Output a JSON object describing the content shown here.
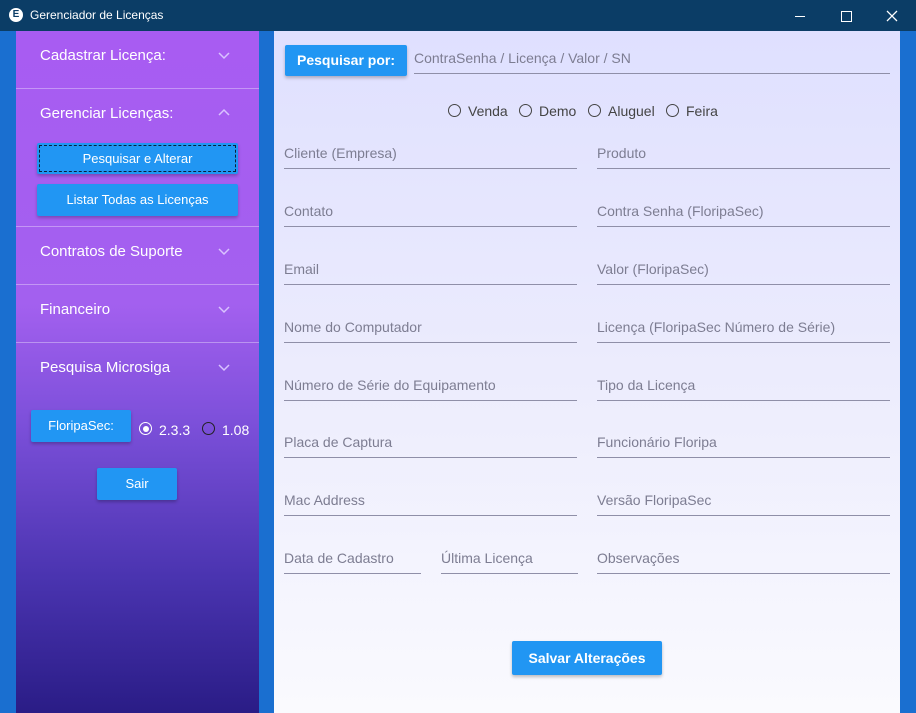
{
  "window": {
    "title": "Gerenciador de Licenças",
    "icon_letter": "E",
    "controls": [
      "minimize-icon",
      "maximize-icon",
      "close-icon"
    ]
  },
  "sidebar": {
    "sections": [
      {
        "label": "Cadastrar Licença:",
        "expanded": false
      },
      {
        "label": "Gerenciar Licenças:",
        "expanded": true
      },
      {
        "label": "Contratos de Suporte",
        "expanded": false
      },
      {
        "label": "Financeiro",
        "expanded": false
      },
      {
        "label": "Pesquisa Microsiga",
        "expanded": false
      }
    ],
    "manage_buttons": {
      "search_alter": "Pesquisar e Alterar",
      "list_all": "Listar Todas as Licenças"
    },
    "floripasec_button": "FloripaSec:",
    "versions": [
      {
        "label": "2.3.3",
        "selected": true
      },
      {
        "label": "1.08",
        "selected": false
      }
    ],
    "exit_button": "Sair"
  },
  "search": {
    "button": "Pesquisar por:",
    "placeholder": "ContraSenha / Licença / Valor / SN"
  },
  "license_type_options": [
    {
      "label": "Venda",
      "selected": false
    },
    {
      "label": "Demo",
      "selected": false
    },
    {
      "label": "Aluguel",
      "selected": false
    },
    {
      "label": "Feira",
      "selected": false
    }
  ],
  "form": {
    "cliente": "Cliente (Empresa)",
    "produto": "Produto",
    "contato": "Contato",
    "contra_senha": "Contra Senha (FloripaSec)",
    "email": "Email",
    "valor": "Valor (FloripaSec)",
    "nome_computador": "Nome do Computador",
    "licenca": "Licença (FloripaSec Número de Série)",
    "numero_serie_equip": "Número de Série do Equipamento",
    "tipo_licenca": "Tipo da Licença",
    "placa_captura": "Placa de Captura",
    "funcionario": "Funcionário Floripa",
    "mac_address": "Mac Address",
    "versao": "Versão FloripaSec",
    "data_cadastro": "Data de Cadastro",
    "ultima_licenca": "Última Licença",
    "observacoes": "Observações"
  },
  "save_button": "Salvar Alterações",
  "colors": {
    "titlebar": "#0b3d66",
    "accent_button": "#2196f3",
    "sidebar_top": "#a85cf2",
    "sidebar_bottom": "#2a1c86",
    "window_frame": "#1a6fd0"
  }
}
